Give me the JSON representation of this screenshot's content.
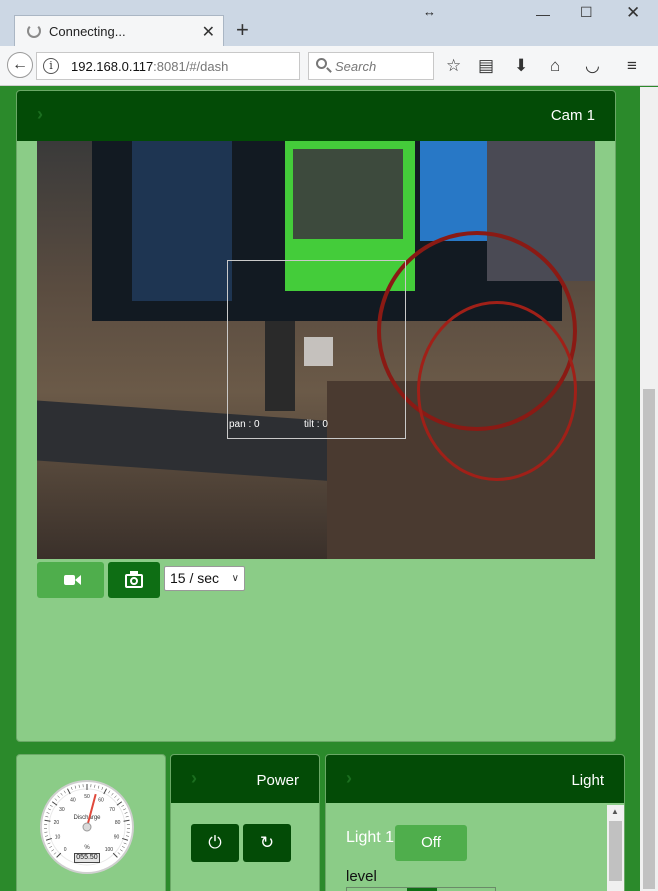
{
  "browser": {
    "tab_title": "Connecting...",
    "url_host": "192.168.0.117",
    "url_rest": ":8081/#/dash",
    "search_placeholder": "Search"
  },
  "cam_panel": {
    "title": "Cam 1",
    "pan_label": "pan : 0",
    "tilt_label": "tilt : 0",
    "fps_selected": "15 / sec"
  },
  "gauge_panel": {
    "value_display": "055.50",
    "caption": "Discharge",
    "ticks": [
      "0",
      "10",
      "20",
      "30",
      "40",
      "50",
      "60",
      "70",
      "80",
      "90",
      "100"
    ],
    "needle_value": 55.5,
    "unit": "%"
  },
  "power_panel": {
    "title": "Power"
  },
  "light_panel": {
    "title": "Light",
    "item_label": "Light 1",
    "toggle_label": "Off",
    "level_label": "level"
  },
  "colors": {
    "page_bg": "#2b8a2b",
    "panel_bg": "#8bcc87",
    "panel_head": "#034b06",
    "button_light": "#4fae4c",
    "button_dark": "#0e6e14"
  },
  "icons": {
    "video": "video-camera-icon",
    "snapshot": "camera-icon",
    "power": "power-icon",
    "reset": "refresh-icon"
  }
}
